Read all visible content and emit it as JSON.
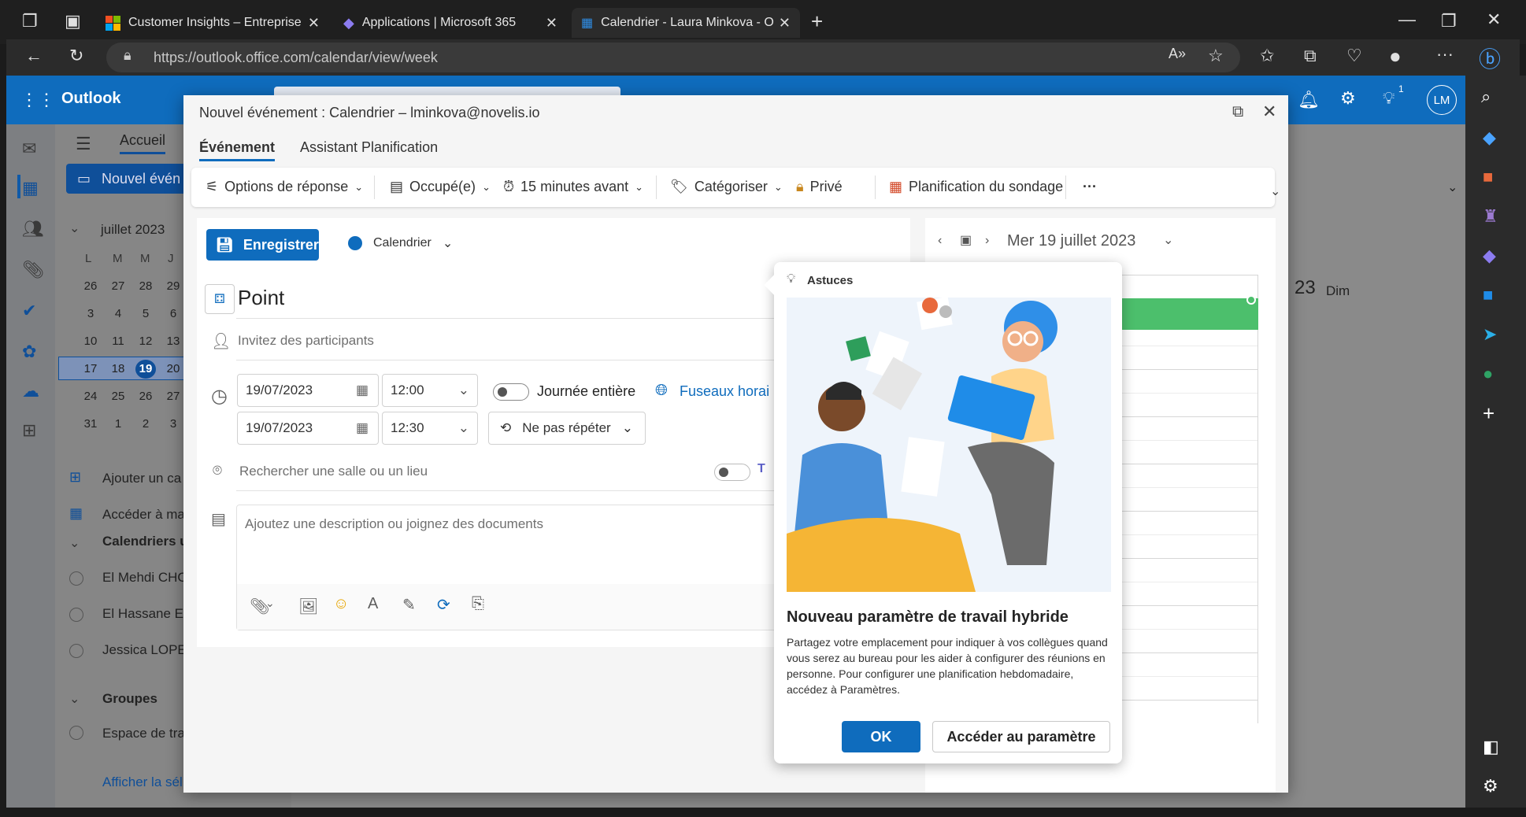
{
  "browser": {
    "tabs": [
      {
        "title": "Customer Insights – Entreprise Cl"
      },
      {
        "title": "Applications | Microsoft 365"
      },
      {
        "title": "Calendrier - Laura Minkova - Out"
      }
    ],
    "url": "https://outlook.office.com/calendar/view/week"
  },
  "outlook": {
    "app_name": "Outlook",
    "nav_tab": "Accueil",
    "new_event_btn": "Nouvel évén",
    "avatar": "LM",
    "notif_count": "1",
    "month_label": "juillet 2023",
    "weekday_headers": [
      "L",
      "M",
      "M",
      "J"
    ],
    "weeks": [
      [
        "26",
        "27",
        "28",
        "29"
      ],
      [
        "3",
        "4",
        "5",
        "6"
      ],
      [
        "10",
        "11",
        "12",
        "13"
      ],
      [
        "17",
        "18",
        "19",
        "20"
      ],
      [
        "24",
        "25",
        "26",
        "27"
      ],
      [
        "31",
        "1",
        "2",
        "3"
      ]
    ],
    "today": "19",
    "add_calendar": "Ajouter un ca",
    "goto_calendar": "Accéder à ma",
    "calendars_section": "Calendriers u",
    "people": [
      "El Mehdi CHO",
      "El Hassane ET",
      "Jessica LOPEZ"
    ],
    "groups_label": "Groupes",
    "group_item": "Espace de tra",
    "show_all": "Afficher la sél",
    "day_header_num": "23",
    "day_header_name": "Dim"
  },
  "dialog": {
    "title": "Nouvel événement : Calendrier – lminkova@novelis.io",
    "tabs": [
      "Événement",
      "Assistant Planification"
    ],
    "toolbar": {
      "response": "Options de réponse",
      "busy": "Occupé(e)",
      "reminder": "15 minutes avant",
      "categorize": "Catégoriser",
      "private": "Privé",
      "poll": "Planification du sondage",
      "more": "···"
    },
    "save": "Enregistrer",
    "calendar": "Calendrier",
    "title_value": "Point",
    "attendees_placeholder": "Invitez des participants",
    "start_date": "19/07/2023",
    "start_time": "12:00",
    "end_date": "19/07/2023",
    "end_time": "12:30",
    "all_day": "Journée entière",
    "timezones": "Fuseaux horai",
    "repeat": "Ne pas répéter",
    "location_placeholder": "Rechercher une salle ou un lieu",
    "description_placeholder": "Ajoutez une description ou joignez des documents",
    "cal_date": "Mer 19 juillet 2023"
  },
  "tips": {
    "header": "Astuces",
    "title": "Nouveau paramètre de travail hybride",
    "body": "Partagez votre emplacement pour indiquer à vos collègues quand vous serez au bureau pour les aider à configurer des réunions en personne. Pour configurer une planification hebdomadaire, accédez à Paramètres.",
    "ok": "OK",
    "settings": "Accéder au paramètre"
  }
}
